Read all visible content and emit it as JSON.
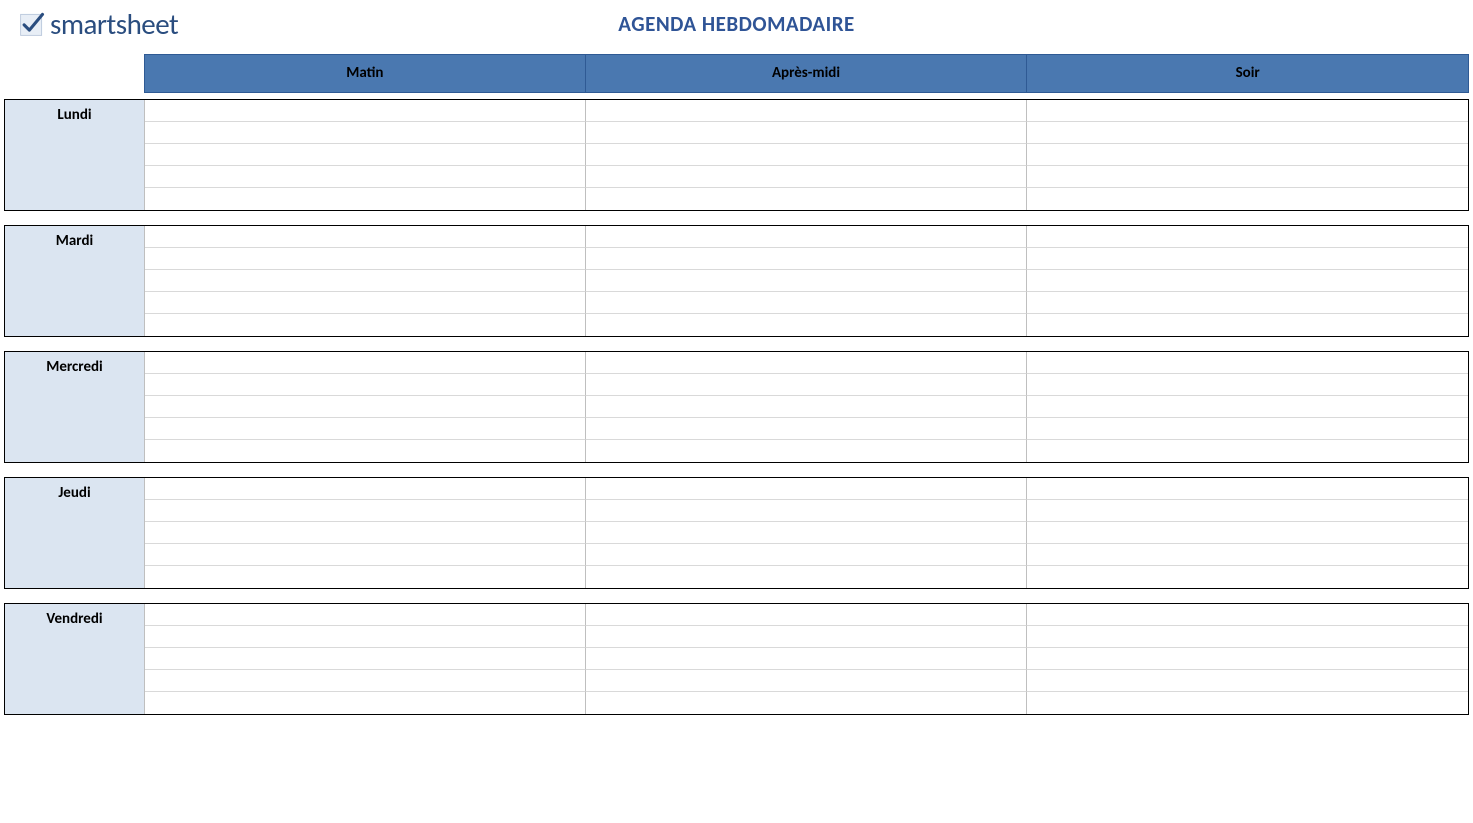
{
  "brand": {
    "name": "smartsheet"
  },
  "title": "AGENDA HEBDOMADAIRE",
  "columns": [
    "Matin",
    "Après-midi",
    "Soir"
  ],
  "days": [
    {
      "label": "Lundi",
      "rows": [
        [
          "",
          "",
          ""
        ],
        [
          "",
          "",
          ""
        ],
        [
          "",
          "",
          ""
        ],
        [
          "",
          "",
          ""
        ],
        [
          "",
          "",
          ""
        ]
      ]
    },
    {
      "label": "Mardi",
      "rows": [
        [
          "",
          "",
          ""
        ],
        [
          "",
          "",
          ""
        ],
        [
          "",
          "",
          ""
        ],
        [
          "",
          "",
          ""
        ],
        [
          "",
          "",
          ""
        ]
      ]
    },
    {
      "label": "Mercredi",
      "rows": [
        [
          "",
          "",
          ""
        ],
        [
          "",
          "",
          ""
        ],
        [
          "",
          "",
          ""
        ],
        [
          "",
          "",
          ""
        ],
        [
          "",
          "",
          ""
        ]
      ]
    },
    {
      "label": "Jeudi",
      "rows": [
        [
          "",
          "",
          ""
        ],
        [
          "",
          "",
          ""
        ],
        [
          "",
          "",
          ""
        ],
        [
          "",
          "",
          ""
        ],
        [
          "",
          "",
          ""
        ]
      ]
    },
    {
      "label": "Vendredi",
      "rows": [
        [
          "",
          "",
          ""
        ],
        [
          "",
          "",
          ""
        ],
        [
          "",
          "",
          ""
        ],
        [
          "",
          "",
          ""
        ],
        [
          "",
          "",
          ""
        ]
      ]
    }
  ]
}
